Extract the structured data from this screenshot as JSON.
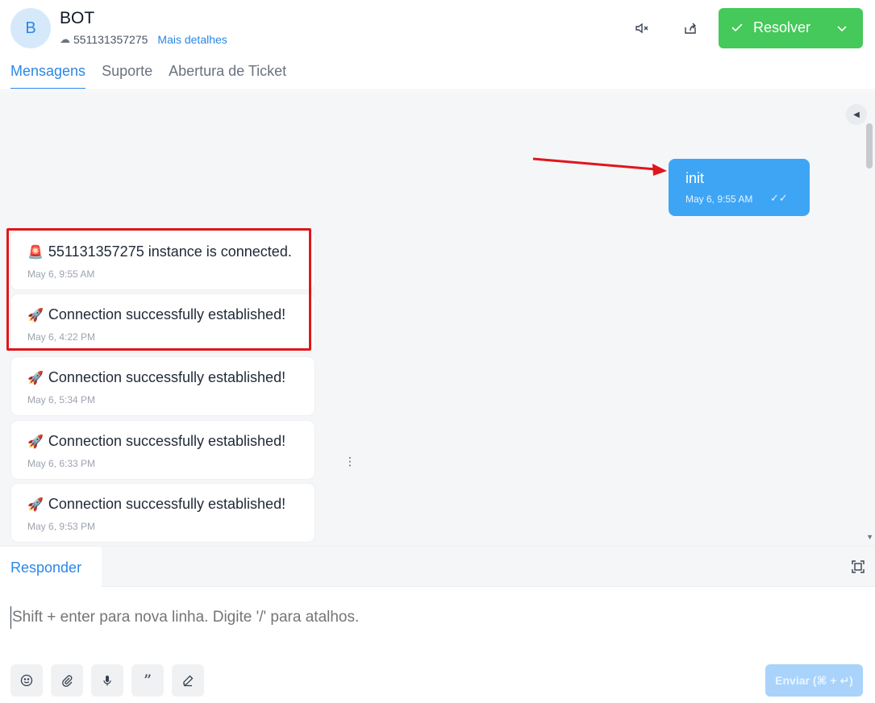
{
  "header": {
    "avatar_initial": "B",
    "contact_name": "BOT",
    "phone": "551131357275",
    "more_details": "Mais detalhes",
    "resolve_label": "Resolver",
    "resolve_color": "#44c95a"
  },
  "tabs": [
    {
      "label": "Mensagens",
      "active": true
    },
    {
      "label": "Suporte",
      "active": false
    },
    {
      "label": "Abertura de Ticket",
      "active": false
    }
  ],
  "messages": {
    "outgoing": {
      "text": "init",
      "time": "May 6, 9:55 AM",
      "ticks": "✓✓"
    },
    "incoming": [
      {
        "emoji": "🚨",
        "text": "551131357275 instance is connected.",
        "time": "May 6, 9:55 AM"
      },
      {
        "emoji": "🚀",
        "text": "Connection successfully established!",
        "time": "May 6, 4:22 PM"
      },
      {
        "emoji": "🚀",
        "text": "Connection successfully established!",
        "time": "May 6, 5:34 PM"
      },
      {
        "emoji": "🚀",
        "text": "Connection successfully established!",
        "time": "May 6, 6:33 PM"
      },
      {
        "emoji": "🚀",
        "text": "Connection successfully established!",
        "time": "May 6, 9:53 PM"
      }
    ]
  },
  "reply": {
    "tab_label": "Responder",
    "placeholder": "Shift + enter para nova linha. Digite '/' para atalhos.",
    "send_label": "Enviar (⌘ + ↵)"
  },
  "colors": {
    "accent": "#2b87e6",
    "outgoing_bubble": "#3ea5f5",
    "annotation": "#e0161b"
  }
}
